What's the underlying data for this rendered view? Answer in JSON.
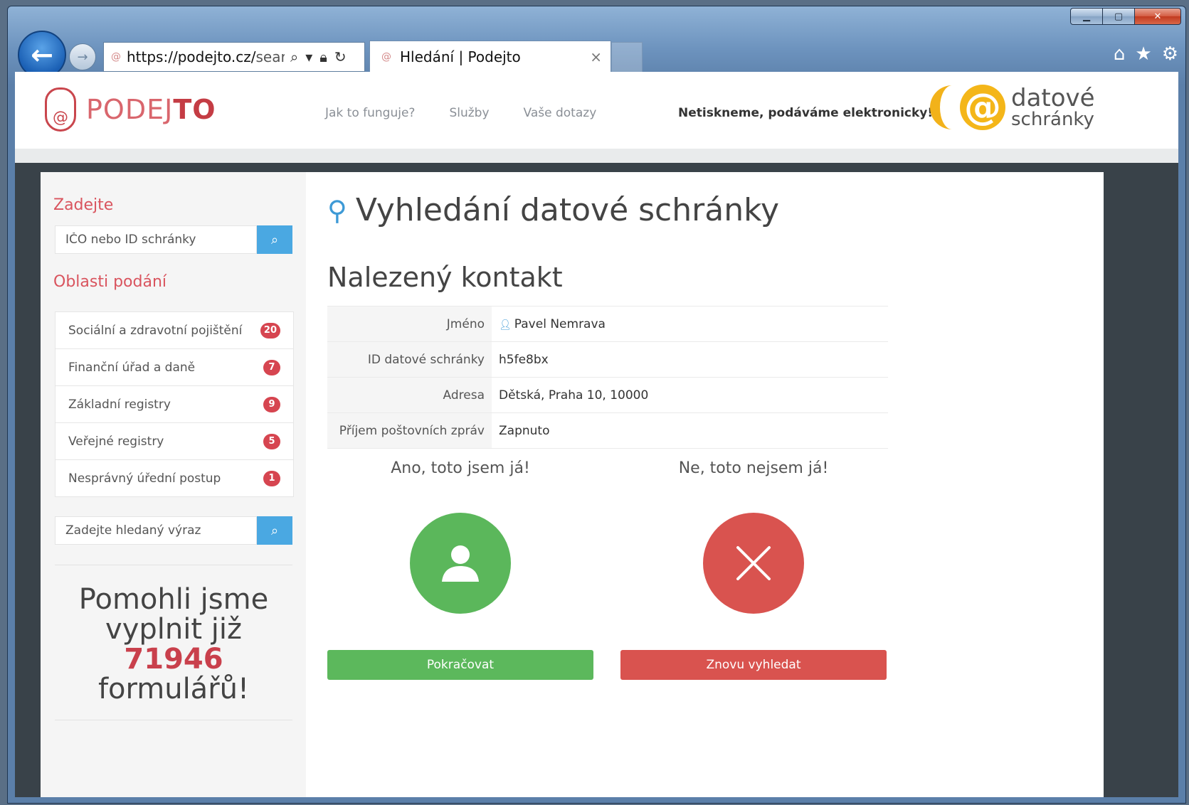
{
  "browser": {
    "url_host": "https://podejto.cz/",
    "url_rest": "sear",
    "tab_title": "Hledání | Podejto",
    "tab_close": "×",
    "window_controls": [
      "▁",
      "▢",
      "✕"
    ]
  },
  "header": {
    "logo_light": "PODEJ",
    "logo_bold": "TO",
    "nav": [
      "Jak to funguje?",
      "Služby",
      "Vaše dotazy"
    ],
    "tagline": "Netiskneme, podáváme elektronicky!",
    "ds_line1": "datové",
    "ds_line2": "schránky"
  },
  "sidebar": {
    "search_label": "Zadejte",
    "search_placeholder": "IČO nebo ID schránky",
    "areas_label": "Oblasti podání",
    "categories": [
      {
        "label": "Sociální a zdravotní pojištění",
        "count": "20"
      },
      {
        "label": "Finanční úřad a daně",
        "count": "7"
      },
      {
        "label": "Základní registry",
        "count": "9"
      },
      {
        "label": "Veřejné registry",
        "count": "5"
      },
      {
        "label": "Nesprávný úřední postup",
        "count": "1"
      }
    ],
    "term_placeholder": "Zadejte hledaný výraz",
    "helped_line1": "Pomohli jsme",
    "helped_line2": "vyplnit již",
    "helped_count": "71946",
    "helped_line3": "formulářů!"
  },
  "main": {
    "title": "Vyhledání datové schránky",
    "section_title": "Nalezený kontakt",
    "contact": [
      {
        "key": "Jméno",
        "value": "Pavel Nemrava"
      },
      {
        "key": "ID datové schránky",
        "value": "h5fe8bx"
      },
      {
        "key": "Adresa",
        "value": "Dětská, Praha 10, 10000"
      },
      {
        "key": "Příjem poštovních zpráv",
        "value": "Zapnuto"
      }
    ],
    "yes_caption": "Ano, toto jsem já!",
    "no_caption": "Ne, toto nejsem já!",
    "continue_label": "Pokračovat",
    "research_label": "Znovu vyhledat"
  },
  "colors": {
    "brand_red": "#c43c44",
    "accent_blue": "#4aa8e2",
    "success_green": "#5cb85c",
    "danger_red": "#d9534f"
  }
}
